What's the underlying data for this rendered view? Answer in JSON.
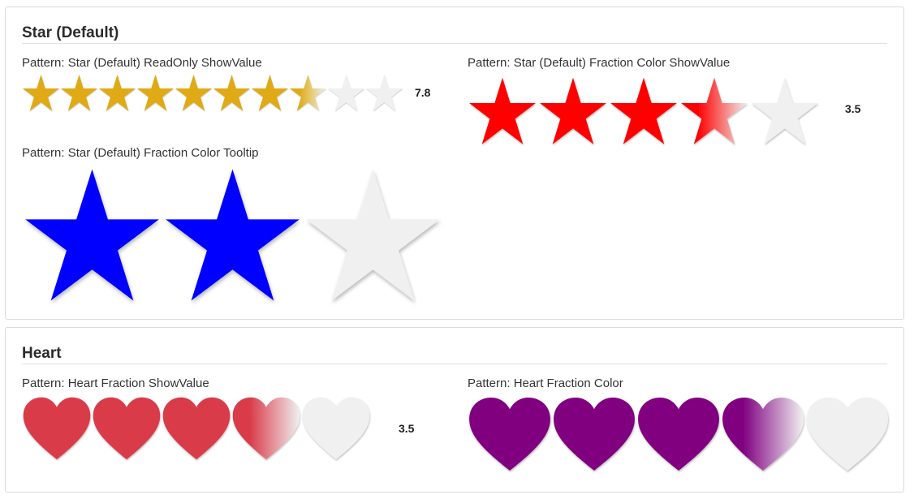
{
  "sections": [
    {
      "title": "Star (Default)",
      "ratings": [
        {
          "label": "Pattern: Star (Default) ReadOnly ShowValue",
          "shape": "star-icon",
          "max": 10,
          "value": 7.8,
          "value_text": "7.8",
          "color": "#dfaa12"
        },
        {
          "label": "Pattern: Star (Default) Fraction Color ShowValue",
          "shape": "star-icon",
          "max": 5,
          "value": 3.5,
          "value_text": "3.5",
          "color": "#ff0000"
        },
        {
          "label": "Pattern: Star (Default) Fraction Color Tooltip",
          "shape": "star-icon",
          "max": 3,
          "value": 2,
          "color": "#0000ff"
        }
      ]
    },
    {
      "title": "Heart",
      "ratings": [
        {
          "label": "Pattern: Heart Fraction ShowValue",
          "shape": "heart-icon",
          "max": 5,
          "value": 3.5,
          "value_text": "3.5",
          "color": "#d93b4a"
        },
        {
          "label": "Pattern: Heart Fraction Color",
          "shape": "heart-icon",
          "max": 5,
          "value": 3.5,
          "color": "#800080"
        }
      ]
    }
  ],
  "empty_color": "#f0f0f0"
}
